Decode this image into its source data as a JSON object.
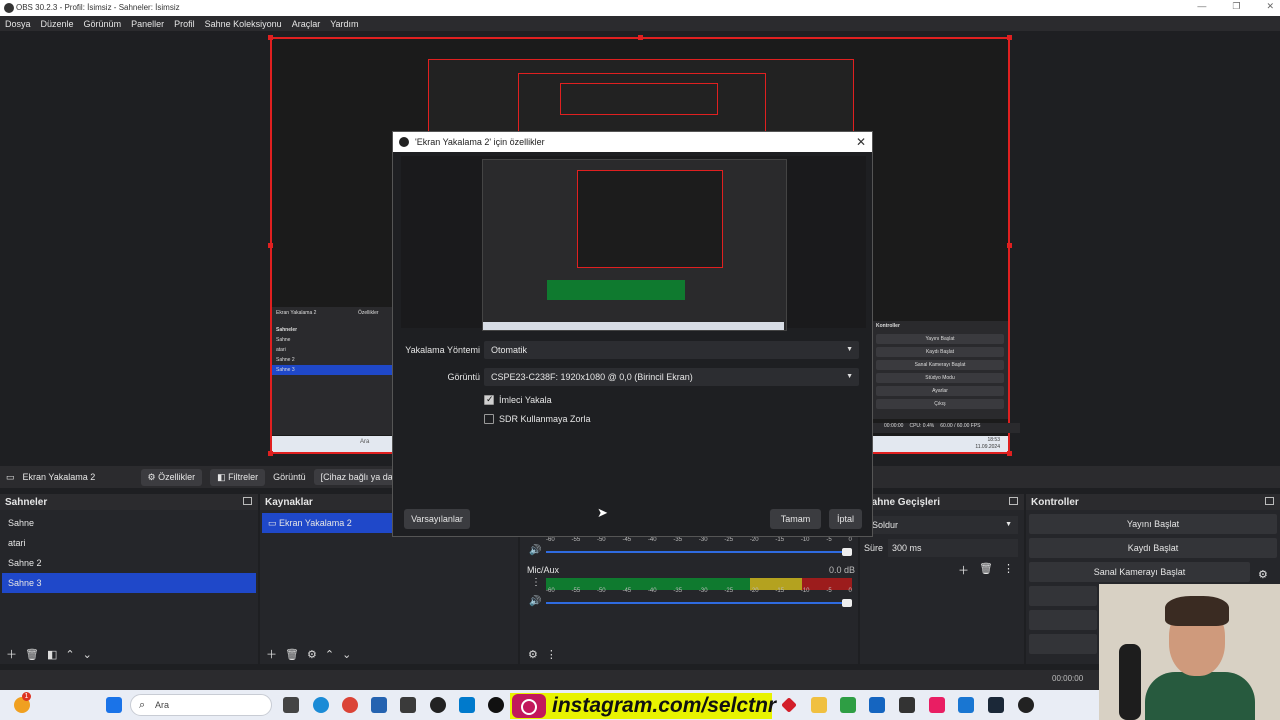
{
  "window": {
    "title": "OBS 30.2.3 - Profil: İsimsiz - Sahneler: İsimsiz"
  },
  "menu": [
    "Dosya",
    "Düzenle",
    "Görünüm",
    "Paneller",
    "Profil",
    "Sahne Koleksiyonu",
    "Araçlar",
    "Yardım"
  ],
  "source_bar": {
    "source_name": "Ekran Yakalama 2",
    "properties": "Özellikler",
    "filters": "Filtreler",
    "display_label": "Görüntü",
    "display_value": "[Cihaz bağlı ya da"
  },
  "scenes": {
    "title": "Sahneler",
    "items": [
      {
        "label": "Sahne",
        "selected": false
      },
      {
        "label": "atari",
        "selected": false
      },
      {
        "label": "Sahne 2",
        "selected": false
      },
      {
        "label": "Sahne 3",
        "selected": true
      }
    ]
  },
  "sources": {
    "title": "Kaynaklar",
    "items": [
      {
        "label": "Ekran Yakalama 2",
        "selected": true
      }
    ]
  },
  "mixer": {
    "scale": [
      "-60",
      "-55",
      "-50",
      "-45",
      "-40",
      "-35",
      "-30",
      "-25",
      "-20",
      "-15",
      "-10",
      "-5",
      "0"
    ],
    "channel2": {
      "name": "Mic/Aux",
      "level": "0.0 dB"
    }
  },
  "transitions": {
    "title": "Sahne Geçişleri",
    "type": "Soldur",
    "duration_label": "Süre",
    "duration_value": "300 ms"
  },
  "controls": {
    "title": "Kontroller",
    "buttons": [
      "Yayını Başlat",
      "Kaydı Başlat",
      "Sanal Kamerayı Başlat"
    ]
  },
  "dialog": {
    "title": "'Ekran Yakalama 2' için özellikler",
    "capture_method_label": "Yakalama Yöntemi",
    "capture_method_value": "Otomatik",
    "display_label": "Görüntü",
    "display_value": "CSPE23-C238F: 1920x1080 @ 0,0 (Birincil Ekran)",
    "cursor_label": "İmleci Yakala",
    "cursor_checked": true,
    "sdr_label": "SDR Kullanmaya Zorla",
    "sdr_checked": false,
    "defaults_button": "Varsayılanlar",
    "ok_button": "Tamam",
    "cancel_button": "İptal"
  },
  "preview_mini": {
    "source_name": "Ekran Yakalama 2",
    "properties": "Özellikler",
    "scenes_title": "Sahneler",
    "scenes": [
      "Sahne",
      "atari",
      "Sahne 2",
      "Sahne 3"
    ],
    "controls_title": "Kontroller",
    "controls": [
      "Yayını Başlat",
      "Kaydı Başlat",
      "Sanal Kamerayı Başlat",
      "Stüdyo Modu",
      "Ayarlar",
      "Çıkış"
    ],
    "status_time": "00:00:00",
    "status_cpu": "CPU: 0.4%",
    "status_fps": "60.00 / 60.00 FPS",
    "clock_time": "18:53",
    "clock_date": "11.09.2024"
  },
  "status": {
    "time": "00:00:00"
  },
  "taskbar": {
    "search_placeholder": "Ara",
    "instagram_text": "instagram.com/selctnr",
    "notification_count": "1"
  },
  "colors": {
    "selection": "#1f48c9",
    "recording_border": "#e02020",
    "banner": "#e8f300"
  }
}
